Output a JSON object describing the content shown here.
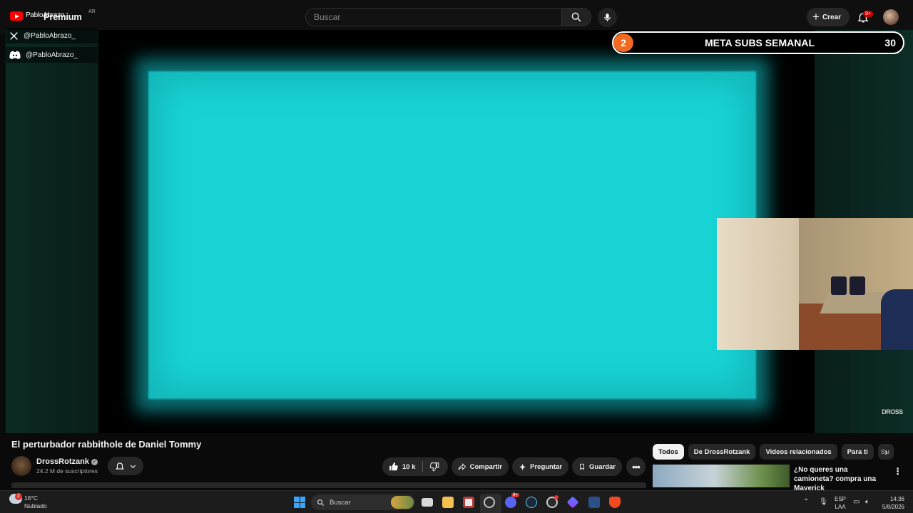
{
  "header": {
    "brand": "Premium",
    "brand_overlay": "PabloAbrazo",
    "country": "AR",
    "search_placeholder": "Buscar",
    "create_label": "Crear",
    "notifications_badge": "9+"
  },
  "social": [
    {
      "network": "x-icon",
      "handle": "@PabloAbrazo_"
    },
    {
      "network": "discord-icon",
      "handle": "@PabloAbrazo_"
    }
  ],
  "goal": {
    "current": "2",
    "title": "META SUBS SEMANAL",
    "target": "30"
  },
  "corner_logo": "DROSS",
  "video": {
    "title": "El perturbador rabbithole de Daniel Tommy",
    "channel": "DrossRotzank",
    "subscribers": "24.2 M de suscriptores",
    "likes": "10 k",
    "share_label": "Compartir",
    "ask_label": "Preguntar",
    "save_label": "Guardar"
  },
  "chips": [
    "Todos",
    "De DrossRotzank",
    "Videos relacionados",
    "Para ti",
    "Su"
  ],
  "recommendation": {
    "title": "¿No queres una camioneta? compra una Maverick"
  },
  "taskbar": {
    "temperature": "16°C",
    "weather": "Nublado",
    "weather_badge": "2",
    "search_label": "Buscar",
    "discord_badge": "9+",
    "language": "ESP",
    "layout": "LAA",
    "time": "14:36",
    "date": "5/8/2026"
  },
  "colors": {
    "goal_accent": "#f06a1f",
    "screen_cyan": "#18d3d3",
    "yt_red": "#ff0000"
  }
}
